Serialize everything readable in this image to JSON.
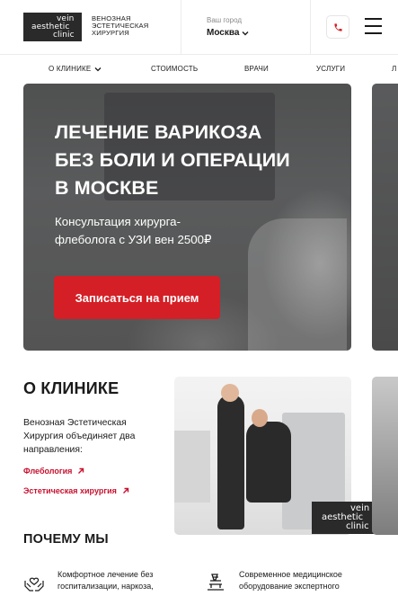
{
  "header": {
    "logo": {
      "line1": "vein",
      "line2": "aesthetic",
      "line3": "clinic"
    },
    "logo_text": [
      "ВЕНОЗНАЯ",
      "ЭСТЕТИЧЕСКАЯ",
      "ХИРУРГИЯ"
    ],
    "city_label": "Ваш город",
    "city_value": "Москва",
    "phone_icon": "phone-icon",
    "menu_icon": "burger-menu-icon"
  },
  "nav": {
    "items": [
      {
        "label": "О КЛИНИКЕ",
        "has_dropdown": true
      },
      {
        "label": "СТОИМОСТЬ"
      },
      {
        "label": "ВРАЧИ"
      },
      {
        "label": "УСЛУГИ"
      },
      {
        "label": "Л"
      }
    ]
  },
  "hero": {
    "title_lines": [
      "ЛЕЧЕНИЕ ВАРИКОЗА",
      "БЕЗ БОЛИ И ОПЕРАЦИИ",
      "В МОСКВЕ"
    ],
    "subtitle_lines": [
      "Консультация хирурга-",
      "флеболога с УЗИ вен 2500₽"
    ],
    "cta_label": "Записаться на прием"
  },
  "about": {
    "title": "О КЛИНИКЕ",
    "description_lines": [
      "Венозная Эстетическая",
      "Хирургия объединяет два",
      "направления:"
    ],
    "links": [
      "Флебология",
      "Эстетическая хирургия"
    ],
    "photo_logo": {
      "line1": "vein",
      "line2": "aesthetic",
      "line3": "clinic"
    }
  },
  "why": {
    "title": "ПОЧЕМУ МЫ",
    "features": [
      {
        "icon": "heart-hands-icon",
        "lines": [
          "Комфортное лечение без",
          "госпитализации, наркоза,"
        ]
      },
      {
        "icon": "microscope-icon",
        "lines": [
          "Современное медицинское",
          "оборудование экспертного"
        ]
      }
    ]
  },
  "colors": {
    "accent": "#d51f26",
    "link": "#c8102e",
    "dark": "#1a1a1a"
  }
}
